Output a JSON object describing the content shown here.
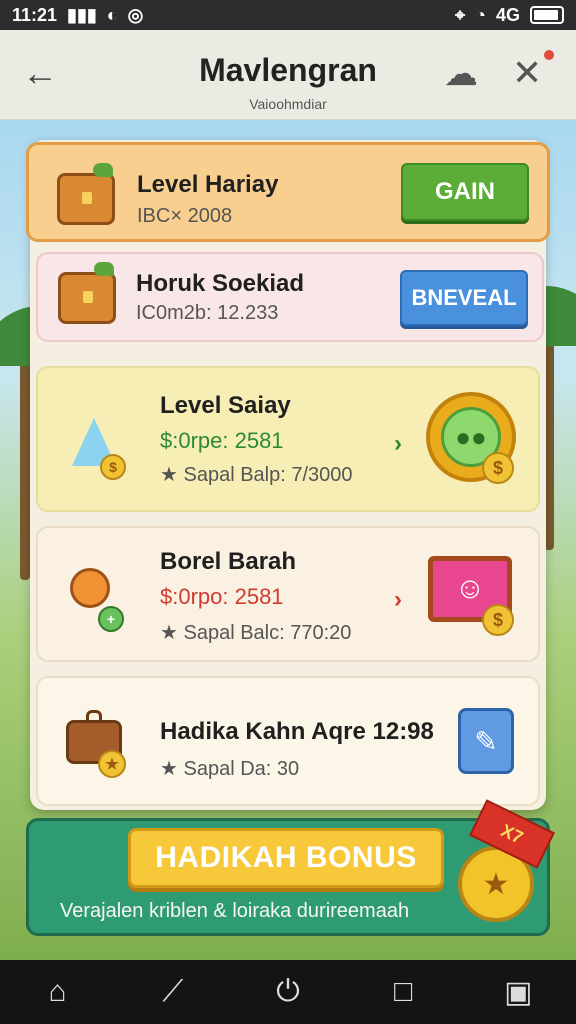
{
  "status_bar": {
    "time": "11:21",
    "carrier": "ı ıl",
    "wifi_icon": "wifi-icon",
    "notification_icon": "alarm-icon",
    "network": "4G"
  },
  "header": {
    "title": "Mavlengran",
    "subtitle": "Vaioohmdiar"
  },
  "cards": [
    {
      "title": "Level Hariay",
      "subtitle": "IBC× 2008",
      "button": "GAIN"
    },
    {
      "title": "Horuk Soekiad",
      "subtitle": "IC0m2b: 12.233",
      "button": "BNEVEAL"
    },
    {
      "title": "Level Saiay",
      "line1": "$:0rpe: 2581",
      "line2": "★ Sapal Balp: 7/3000"
    },
    {
      "title": "Borel Barah",
      "line1": "$:0rpo: 2581",
      "line2": "★ Sapal Balc: 770:20"
    },
    {
      "title": "Hadika Kahn Aqre 12:98",
      "line2": "★ Sapal Da: 30"
    }
  ],
  "bonus": {
    "button": "HADIKAH BONUS",
    "ribbon": "X7",
    "text": "Verajalen kriblen & loiraka durireemaah"
  },
  "nav": {
    "home_icon": "home-icon",
    "trend_icon": "trend-icon",
    "power_icon": "power-icon",
    "square_icon": "square-icon",
    "widgets_icon": "widgets-icon"
  }
}
